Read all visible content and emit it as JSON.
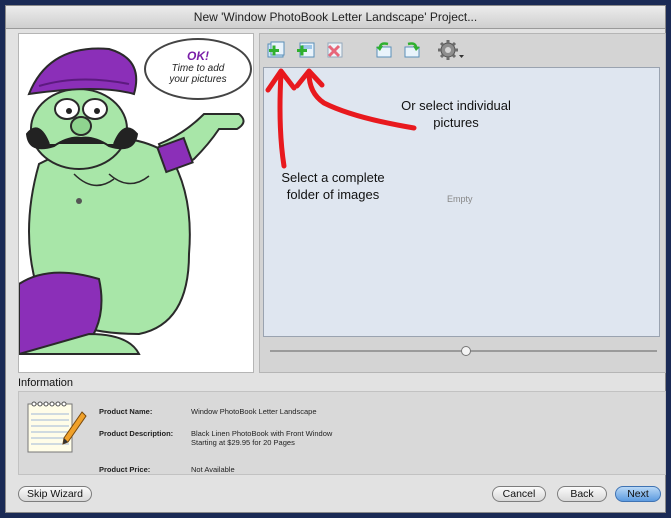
{
  "window": {
    "title": "New 'Window PhotoBook Letter Landscape' Project..."
  },
  "mascot": {
    "bubble_exclaim": "OK!",
    "bubble_line1": "Time to add",
    "bubble_line2": "your pictures"
  },
  "toolbar": {
    "icons": [
      "add-folder-icon",
      "add-pictures-icon",
      "remove-pictures-icon",
      "rotate-left-icon",
      "rotate-right-icon",
      "gear-menu-icon"
    ]
  },
  "picture_area": {
    "empty_label": "Empty",
    "annotation_individual_line1": "Or select individual",
    "annotation_individual_line2": "pictures",
    "annotation_folder_line1": "Select a complete",
    "annotation_folder_line2": "folder of images",
    "annotation_color": "#e8191e"
  },
  "information": {
    "heading": "Information",
    "product_name_label": "Product Name:",
    "product_name_value": "Window PhotoBook Letter Landscape",
    "product_description_label": "Product Description:",
    "product_description_line1": "Black Linen PhotoBook with Front Window",
    "product_description_line2": "Starting at $29.95 for 20 Pages",
    "product_price_label": "Product Price:",
    "product_price_value": "Not Available"
  },
  "buttons": {
    "skip_wizard": "Skip Wizard",
    "cancel": "Cancel",
    "back": "Back",
    "next": "Next"
  },
  "colors": {
    "accent_blue": "#5c9be0",
    "mascot_purple": "#8b2fb8",
    "mascot_green": "#9fe0a0"
  }
}
